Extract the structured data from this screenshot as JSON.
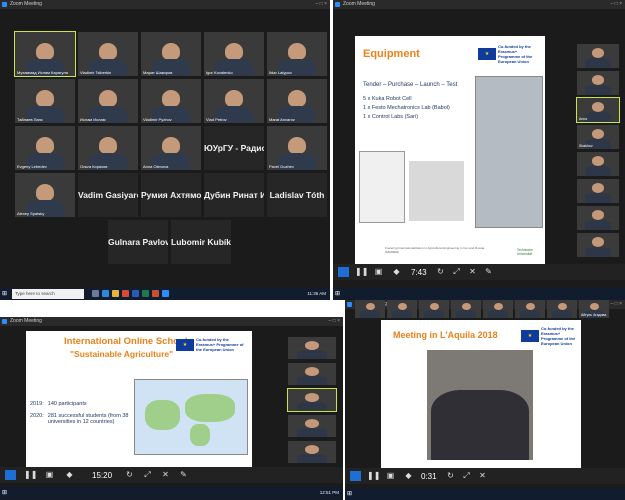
{
  "window_title": "Zoom Meeting",
  "q1": {
    "tiles": [
      {
        "name": "Мухаммад Ислам Карагуля"
      },
      {
        "name": "Vladimir Tsiberkin"
      },
      {
        "name": "Марат Шакиров"
      },
      {
        "name": "Igor Kovalenko"
      },
      {
        "name": "Ildar Latypov"
      },
      {
        "name": "Тайлаев Ланс"
      },
      {
        "name": "Ислам Ислам"
      },
      {
        "name": "Vladimir Pyzhov"
      },
      {
        "name": "Vlad Petrov"
      },
      {
        "name": "Marat Anvarov"
      },
      {
        "name": "Evgeny Lebedev"
      },
      {
        "name": "Ольга Кориков"
      },
      {
        "name": "Anna Olenova"
      },
      {
        "name": "ЮУрГУ - Радио...",
        "big": true
      },
      {
        "name": "Pavel Guzhev"
      },
      {
        "name": "Alexey Spatsky"
      },
      {
        "name": "Vadim Gasiyarov",
        "big": true
      },
      {
        "name": "Румия Ахтямов...",
        "big": true
      },
      {
        "name": "Дубин Ринат Ис...",
        "big": true
      },
      {
        "name": "Ladislav Tóth",
        "big": true
      },
      {
        "name": "Gulnara Pavlova",
        "big": true
      },
      {
        "name": "Lubomir Kubík",
        "big": true
      }
    ],
    "taskbar_search": "Type here to search",
    "clock": "11:36 AM"
  },
  "q2": {
    "title": "Equipment",
    "eu_text": "Co-funded by the Erasmus+ Programme of the European Union",
    "subtitle": "Tender – Purchase – Launch – Test",
    "bullets": [
      "5 x Kuka Robot Cell",
      "1 x Festo Mechatronics Lab (Babol)",
      "1 x Control Labs (Sari)"
    ],
    "footer": "Fostering Internationalization in Agricultural Engineering in Iran and Russia [FARMER]",
    "univ": "Technische Universität",
    "timer": "7:43",
    "side_names": [
      "",
      "",
      "Anna",
      "Shakhov",
      "",
      "",
      "",
      ""
    ]
  },
  "q3": {
    "title1": "International Online School",
    "title2": "\"Sustainable Agriculture\"",
    "eu_text": "Co-funded by the Erasmus+ Programme of the European Union",
    "stats": [
      {
        "year": "2019:",
        "text": "140 participants"
      },
      {
        "year": "2020:",
        "text": "281 successful students (from 38 universities in 12 countries)"
      }
    ],
    "timer": "15:20",
    "clock": "12:51 PM"
  },
  "q4": {
    "title": "Meeting in L'Aquila 2018",
    "eu_text": "Co-funded by the Erasmus+ Programme of the European Union",
    "timer": "0:31",
    "top_names": [
      "",
      "",
      "",
      "",
      "",
      "",
      "",
      "Айгуль Агадова"
    ]
  },
  "colors": {
    "zoom_bg": "#1b1b1b",
    "accent_orange": "#e8821a",
    "eu_blue": "#0f3c9c",
    "active_border": "#c7e44a",
    "zoom_blue": "#1d6fd6"
  }
}
